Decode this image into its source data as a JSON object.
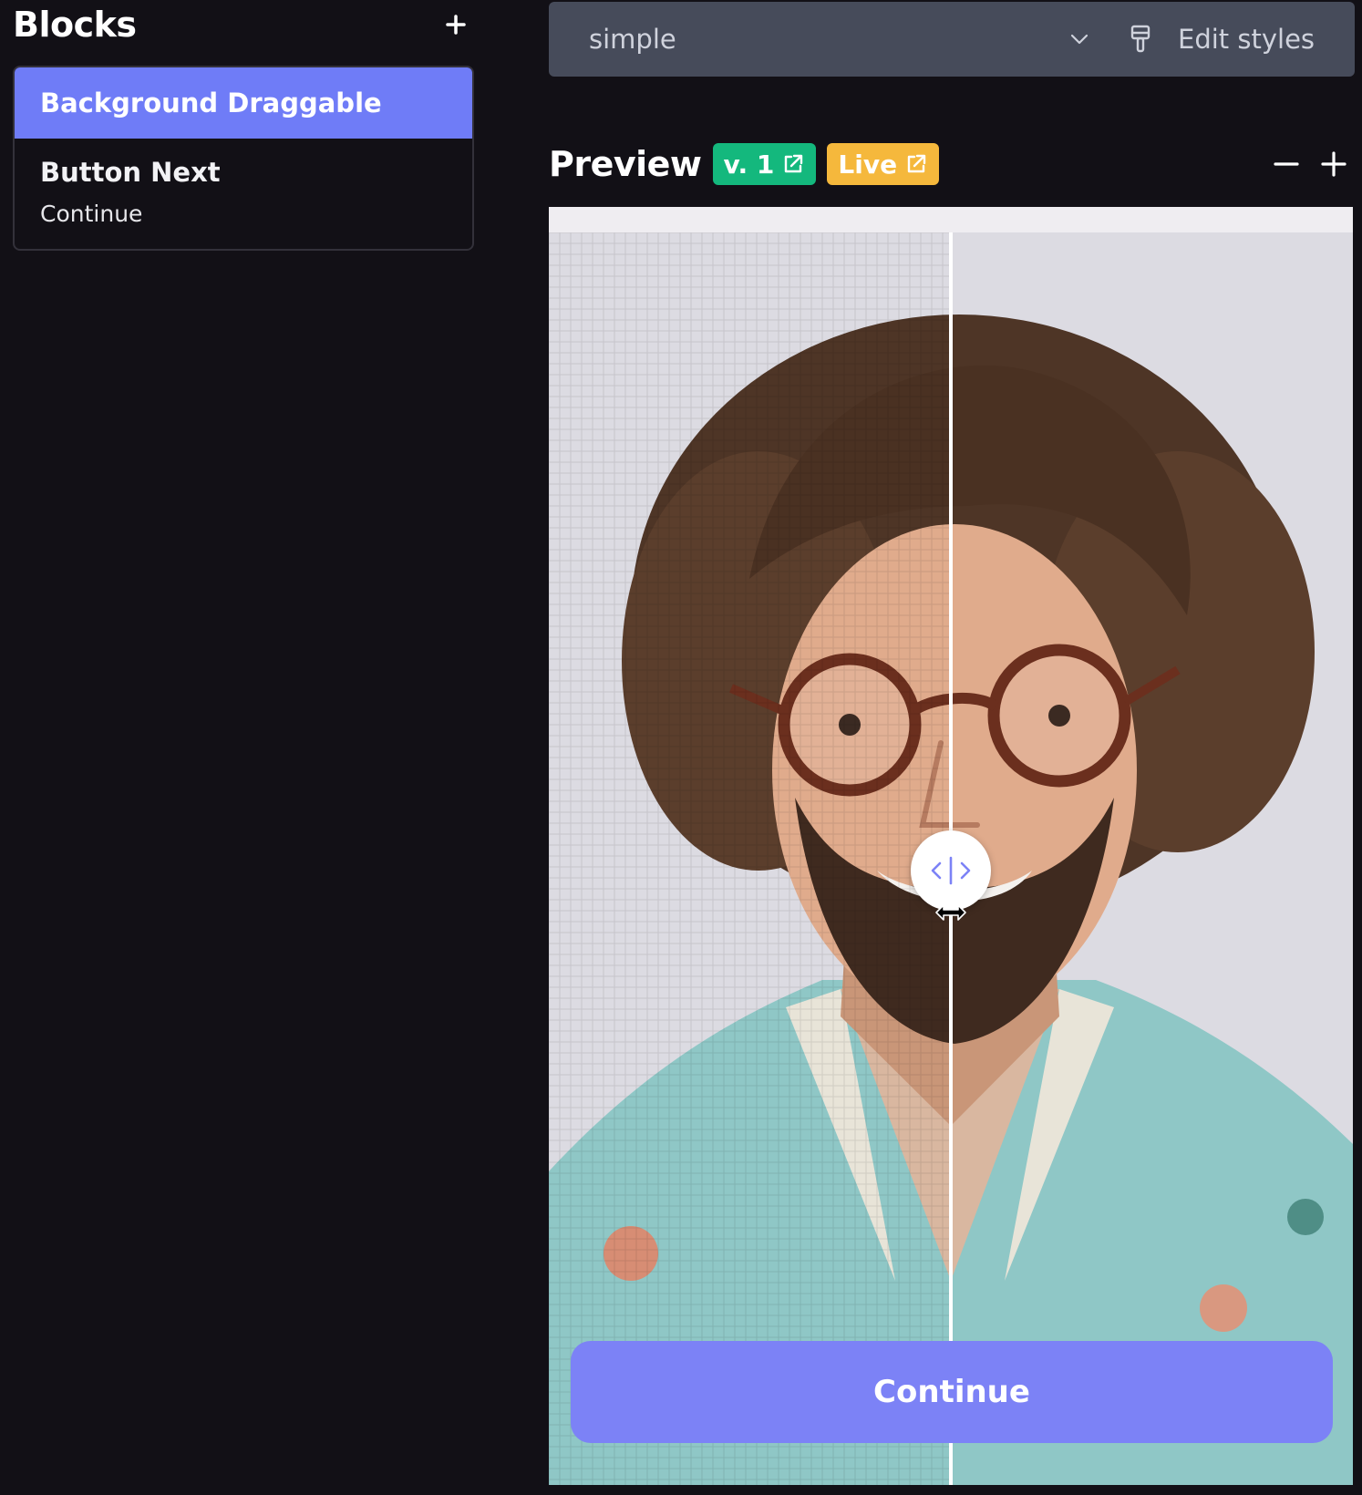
{
  "sidebar": {
    "title": "Blocks",
    "add_icon": "plus-icon",
    "items": [
      {
        "title": "Background Draggable",
        "subtitle": "",
        "active": true
      },
      {
        "title": "Button Next",
        "subtitle": "Continue",
        "active": false
      }
    ]
  },
  "topbar": {
    "style_select_value": "simple",
    "chevron_icon": "chevron-down-icon",
    "edit_styles_label": "Edit styles",
    "edit_styles_icon": "brush-icon"
  },
  "preview": {
    "title": "Preview",
    "version_badge": "v. 1",
    "live_badge": "Live",
    "badge_icon": "external-link-icon",
    "zoom_out_icon": "minus-icon",
    "zoom_in_icon": "plus-icon",
    "slider_position": 0.5,
    "continue_label": "Continue"
  },
  "colors": {
    "background": "#121016",
    "accent": "#6f7cf7",
    "button": "#7c82f6",
    "version_badge": "#14b87d",
    "live_badge": "#f5b83c",
    "topbar": "#464b5a"
  }
}
